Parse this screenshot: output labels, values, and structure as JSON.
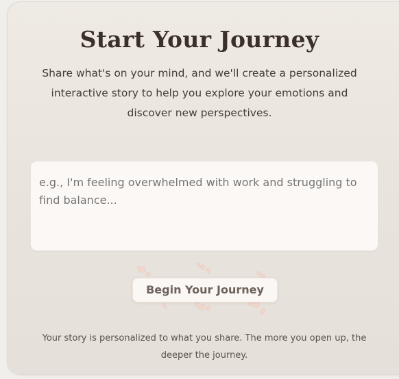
{
  "header": {
    "title": "Start Your Journey",
    "subtitle": "Share what's on your mind, and we'll create a personalized interactive story to help you explore your emotions and discover new perspectives."
  },
  "journal_input": {
    "placeholder": "e.g., I'm feeling overwhelmed with work and struggling to find balance...",
    "value": ""
  },
  "actions": {
    "begin_label": "Begin Your Journey"
  },
  "footer": {
    "note": "Your story is personalized to what you share. The more you open up, the deeper the journey."
  },
  "colors": {
    "card_background": "#ebe5df",
    "title": "#3a2f2a",
    "button_text": "#6e625c",
    "petal": "#f0d2c8"
  },
  "icons": {
    "decoration": "flower-petals-icon"
  }
}
